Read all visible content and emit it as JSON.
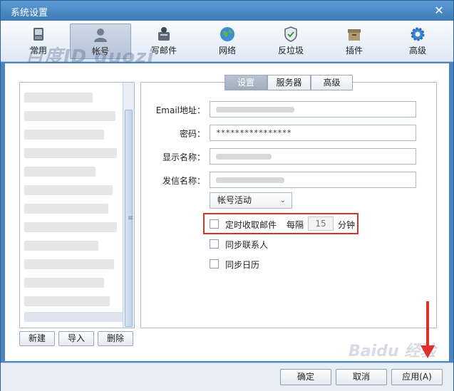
{
  "window": {
    "title": "系统设置",
    "close_glyph": "✕"
  },
  "watermark": "百度ID guozi",
  "watermark_bottom": "Baidu 经验",
  "toolbar": {
    "items": [
      {
        "label": "常用",
        "icon": "phone-icon"
      },
      {
        "label": "帐号",
        "icon": "account-icon",
        "active": true
      },
      {
        "label": "写邮件",
        "icon": "compose-icon"
      },
      {
        "label": "网络",
        "icon": "globe-icon"
      },
      {
        "label": "反垃圾",
        "icon": "shield-icon"
      },
      {
        "label": "插件",
        "icon": "box-icon"
      },
      {
        "label": "高级",
        "icon": "gear-icon"
      }
    ]
  },
  "account_list_buttons": {
    "new": "新建",
    "import": "导入",
    "delete": "删除"
  },
  "tabs": [
    {
      "label": "设置",
      "selected": true
    },
    {
      "label": "服务器"
    },
    {
      "label": "高级"
    }
  ],
  "form": {
    "email_label": "Email地址：",
    "password_label": "密码：",
    "password_value": "****************",
    "display_name_label": "显示名称：",
    "sender_name_label": "发信名称："
  },
  "account_activity_select": "帐号活动",
  "options": {
    "auto_receive_label": "定时收取邮件",
    "every_label": "每隔",
    "interval_value": "15",
    "minutes_label": "分钟",
    "sync_contacts_label": "同步联系人",
    "sync_calendar_label": "同步日历"
  },
  "footer": {
    "ok": "确定",
    "cancel": "取消",
    "apply": "应用(A)"
  },
  "colors": {
    "highlight": "#d9342c",
    "arrow": "#e0302a",
    "window_frame": "#4a86bf"
  }
}
